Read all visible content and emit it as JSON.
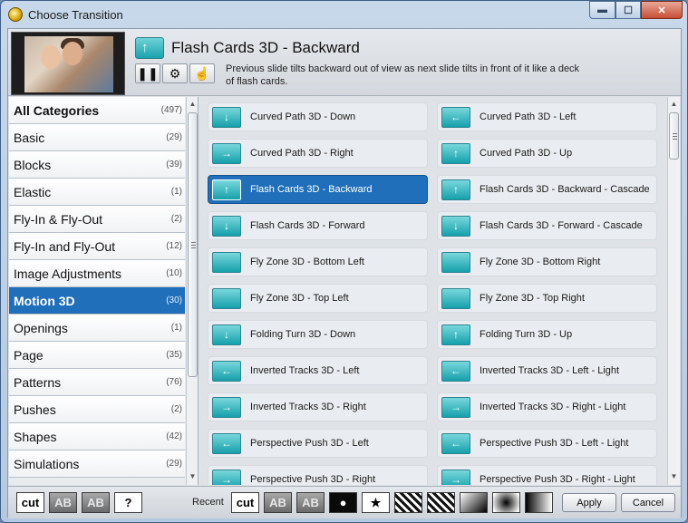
{
  "window": {
    "title": "Choose Transition"
  },
  "header": {
    "transition_title": "Flash Cards 3D - Backward",
    "description": "Previous slide tilts backward out of view as next slide tilts in front of it like a deck of flash cards.",
    "buttons": [
      {
        "icon": "pause-icon"
      },
      {
        "icon": "gear-icon"
      },
      {
        "icon": "hand-pointer-icon"
      }
    ]
  },
  "categories": [
    {
      "name": "All Categories",
      "count": "(497)",
      "bold": true
    },
    {
      "name": "Basic",
      "count": "(29)"
    },
    {
      "name": "Blocks",
      "count": "(39)"
    },
    {
      "name": "Elastic",
      "count": "(1)"
    },
    {
      "name": "Fly-In & Fly-Out",
      "count": "(2)"
    },
    {
      "name": "Fly-In and Fly-Out",
      "count": "(12)"
    },
    {
      "name": "Image Adjustments",
      "count": "(10)"
    },
    {
      "name": "Motion 3D",
      "count": "(30)",
      "selected": true
    },
    {
      "name": "Openings",
      "count": "(1)"
    },
    {
      "name": "Page",
      "count": "(35)"
    },
    {
      "name": "Patterns",
      "count": "(76)"
    },
    {
      "name": "Pushes",
      "count": "(2)"
    },
    {
      "name": "Shapes",
      "count": "(42)"
    },
    {
      "name": "Simulations",
      "count": "(29)"
    }
  ],
  "transitions": [
    {
      "label": "Curved Path 3D - Down",
      "glyph": "↓"
    },
    {
      "label": "Curved Path 3D - Left",
      "glyph": "←"
    },
    {
      "label": "Curved Path 3D - Right",
      "glyph": "→"
    },
    {
      "label": "Curved Path 3D - Up",
      "glyph": "↑"
    },
    {
      "label": "Flash Cards 3D - Backward",
      "glyph": "↑",
      "selected": true
    },
    {
      "label": "Flash Cards 3D - Backward - Cascade",
      "glyph": "↑"
    },
    {
      "label": "Flash Cards 3D - Forward",
      "glyph": "↓"
    },
    {
      "label": "Flash Cards 3D - Forward - Cascade",
      "glyph": "↓"
    },
    {
      "label": "Fly Zone 3D - Bottom Left",
      "glyph": ""
    },
    {
      "label": "Fly Zone 3D - Bottom Right",
      "glyph": ""
    },
    {
      "label": "Fly Zone 3D - Top Left",
      "glyph": ""
    },
    {
      "label": "Fly Zone 3D - Top Right",
      "glyph": ""
    },
    {
      "label": "Folding Turn 3D - Down",
      "glyph": "↓"
    },
    {
      "label": "Folding Turn 3D - Up",
      "glyph": "↑"
    },
    {
      "label": "Inverted Tracks 3D - Left",
      "glyph": "←"
    },
    {
      "label": "Inverted Tracks 3D - Left - Light",
      "glyph": "←"
    },
    {
      "label": "Inverted Tracks 3D - Right",
      "glyph": "→"
    },
    {
      "label": "Inverted Tracks 3D - Right - Light",
      "glyph": "→"
    },
    {
      "label": "Perspective Push 3D - Left",
      "glyph": "←"
    },
    {
      "label": "Perspective Push 3D - Left - Light",
      "glyph": "←"
    },
    {
      "label": "Perspective Push 3D - Right",
      "glyph": "→"
    },
    {
      "label": "Perspective Push 3D - Right - Light",
      "glyph": "→"
    }
  ],
  "footer": {
    "left_buttons": [
      {
        "text": "cut",
        "style": "white",
        "name": "cut-button"
      },
      {
        "text": "AB",
        "style": "gray",
        "name": "crossfade-button"
      },
      {
        "text": "AB",
        "style": "gray",
        "name": "dissolve-button"
      },
      {
        "text": "?",
        "style": "white",
        "name": "random-button"
      }
    ],
    "recent_label": "Recent",
    "recent_buttons": [
      {
        "text": "cut",
        "style": "white",
        "name": "recent-cut-button"
      },
      {
        "text": "AB",
        "style": "gray",
        "name": "recent-crossfade-button"
      },
      {
        "text": "AB",
        "style": "gray",
        "name": "recent-dissolve-button"
      },
      {
        "text": "●",
        "style": "dark",
        "name": "recent-circle-button"
      },
      {
        "text": "★",
        "style": "white",
        "name": "recent-star-button"
      },
      {
        "text": "",
        "style": "pattern",
        "name": "recent-pattern-button"
      },
      {
        "text": "",
        "style": "pattern",
        "name": "recent-pattern2-button"
      },
      {
        "text": "",
        "style": "grad1",
        "name": "recent-gradient-button"
      },
      {
        "text": "",
        "style": "grad2",
        "name": "recent-radial-button"
      },
      {
        "text": "",
        "style": "grad3",
        "name": "recent-wipe-button"
      }
    ],
    "apply_label": "Apply",
    "cancel_label": "Cancel"
  },
  "colors": {
    "selected": "#1f6fba",
    "tile_icon": "#16a0ab"
  }
}
